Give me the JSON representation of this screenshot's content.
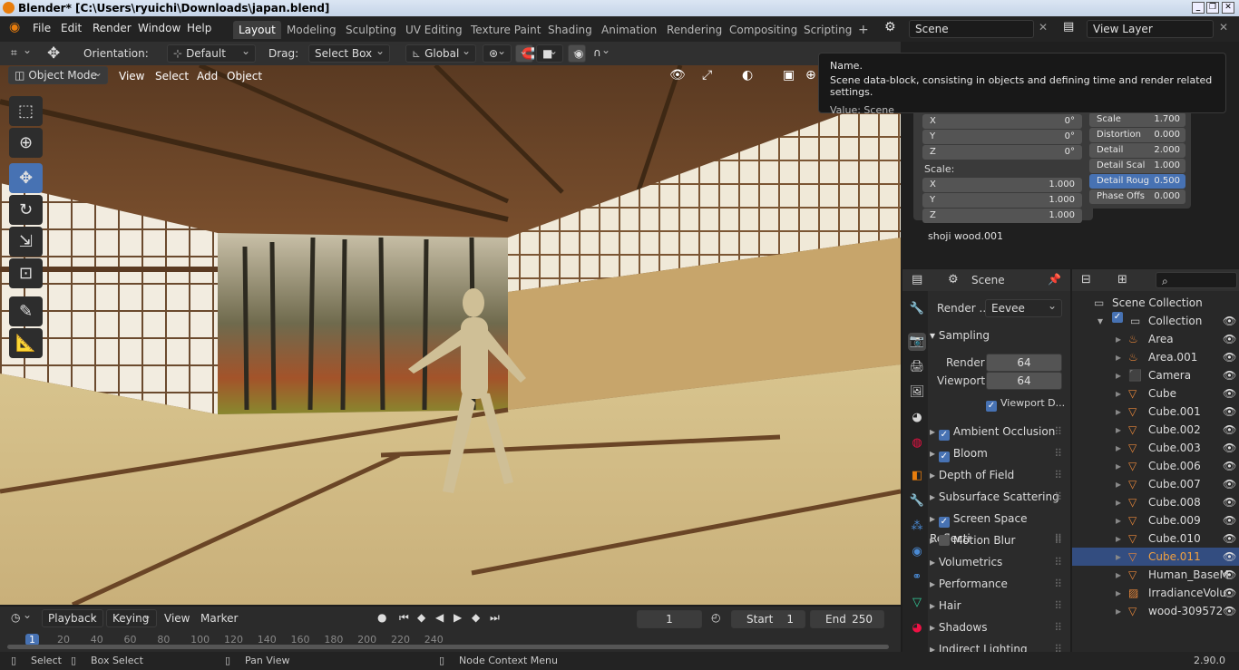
{
  "window": {
    "title": "Blender* [C:\\Users\\ryuichi\\Downloads\\japan.blend]"
  },
  "menu": {
    "file": "File",
    "edit": "Edit",
    "render": "Render",
    "window": "Window",
    "help": "Help"
  },
  "workspaces": [
    "Layout",
    "Modeling",
    "Sculpting",
    "UV Editing",
    "Texture Paint",
    "Shading",
    "Animation",
    "Rendering",
    "Compositing",
    "Scripting"
  ],
  "scene_selector": {
    "value": "Scene"
  },
  "view_layer": {
    "value": "View Layer"
  },
  "header": {
    "orientation_label": "Orientation:",
    "orientation_value": "Default",
    "drag_label": "Drag:",
    "drag_value": "Select Box",
    "transform_value": "Global"
  },
  "viewport_header": {
    "mode": "Object Mode",
    "view": "View",
    "select": "Select",
    "add": "Add",
    "object": "Object"
  },
  "tooltip": {
    "title": "Name.",
    "desc": "Scene data-block, consisting in objects and defining time and render related settings.",
    "value": "Value: Scene"
  },
  "node": {
    "rot_x": "X",
    "rot_x_val": "0°",
    "rot_y": "Y",
    "rot_y_val": "0°",
    "rot_z": "Z",
    "rot_z_val": "0°",
    "scale_label": "Scale:",
    "sc_x": "X",
    "sc_x_val": "1.000",
    "sc_y": "Y",
    "sc_y_val": "1.000",
    "sc_z": "Z",
    "sc_z_val": "1.000",
    "noise_scale": "Scale",
    "noise_scale_val": "1.700",
    "distortion": "Distortion",
    "distortion_val": "0.000",
    "detail": "Detail",
    "detail_val": "2.000",
    "detail_scale": "Detail Scal",
    "detail_scale_val": "1.000",
    "detail_rough": "Detail Roug",
    "detail_rough_val": "0.500",
    "phase": "Phase Offs",
    "phase_val": "0.000",
    "frame_label": "shoji wood.001"
  },
  "properties": {
    "context": "Scene",
    "render_engine_label": "Render ...",
    "render_engine": "Eevee",
    "sampling": "Sampling",
    "render_label": "Render",
    "render_samples": "64",
    "viewport_label": "Viewport",
    "viewport_samples": "64",
    "viewport_denoise": "Viewport D...",
    "panels": [
      {
        "label": "Ambient Occlusion",
        "checkbox": true,
        "checked": true
      },
      {
        "label": "Bloom",
        "checkbox": true,
        "checked": true
      },
      {
        "label": "Depth of Field",
        "checkbox": false
      },
      {
        "label": "Subsurface Scattering",
        "checkbox": false
      },
      {
        "label": "Screen Space Reflecti",
        "checkbox": true,
        "checked": true
      },
      {
        "label": "Motion Blur",
        "checkbox": true,
        "checked": false
      },
      {
        "label": "Volumetrics",
        "checkbox": false
      },
      {
        "label": "Performance",
        "checkbox": false
      },
      {
        "label": "Hair",
        "checkbox": false
      },
      {
        "label": "Shadows",
        "checkbox": false
      },
      {
        "label": "Indirect Lighting",
        "checkbox": false
      }
    ]
  },
  "outliner": {
    "root": "Scene Collection",
    "collection": "Collection",
    "items": [
      {
        "name": "Area",
        "kind": "light"
      },
      {
        "name": "Area.001",
        "kind": "light"
      },
      {
        "name": "Camera",
        "kind": "camera"
      },
      {
        "name": "Cube",
        "kind": "mesh"
      },
      {
        "name": "Cube.001",
        "kind": "mesh"
      },
      {
        "name": "Cube.002",
        "kind": "mesh"
      },
      {
        "name": "Cube.003",
        "kind": "mesh"
      },
      {
        "name": "Cube.006",
        "kind": "mesh"
      },
      {
        "name": "Cube.007",
        "kind": "mesh"
      },
      {
        "name": "Cube.008",
        "kind": "mesh"
      },
      {
        "name": "Cube.009",
        "kind": "mesh"
      },
      {
        "name": "Cube.010",
        "kind": "mesh"
      },
      {
        "name": "Cube.011",
        "kind": "mesh",
        "selected": true
      },
      {
        "name": "Human_BaseM",
        "kind": "mesh"
      },
      {
        "name": "IrradianceVolu",
        "kind": "probe"
      },
      {
        "name": "wood-309572",
        "kind": "mesh"
      }
    ]
  },
  "timeline": {
    "playback": "Playback",
    "keying": "Keying",
    "view": "View",
    "marker": "Marker",
    "current_frame": "1",
    "start_label": "Start",
    "start": "1",
    "end_label": "End",
    "end": "250",
    "ruler": [
      "1",
      "20",
      "40",
      "60",
      "80",
      "100",
      "120",
      "140",
      "160",
      "180",
      "200",
      "220",
      "240"
    ]
  },
  "status": {
    "select": "Select",
    "box_select": "Box Select",
    "pan_view": "Pan View",
    "node_menu": "Node Context Menu",
    "version": "2.90.0"
  }
}
